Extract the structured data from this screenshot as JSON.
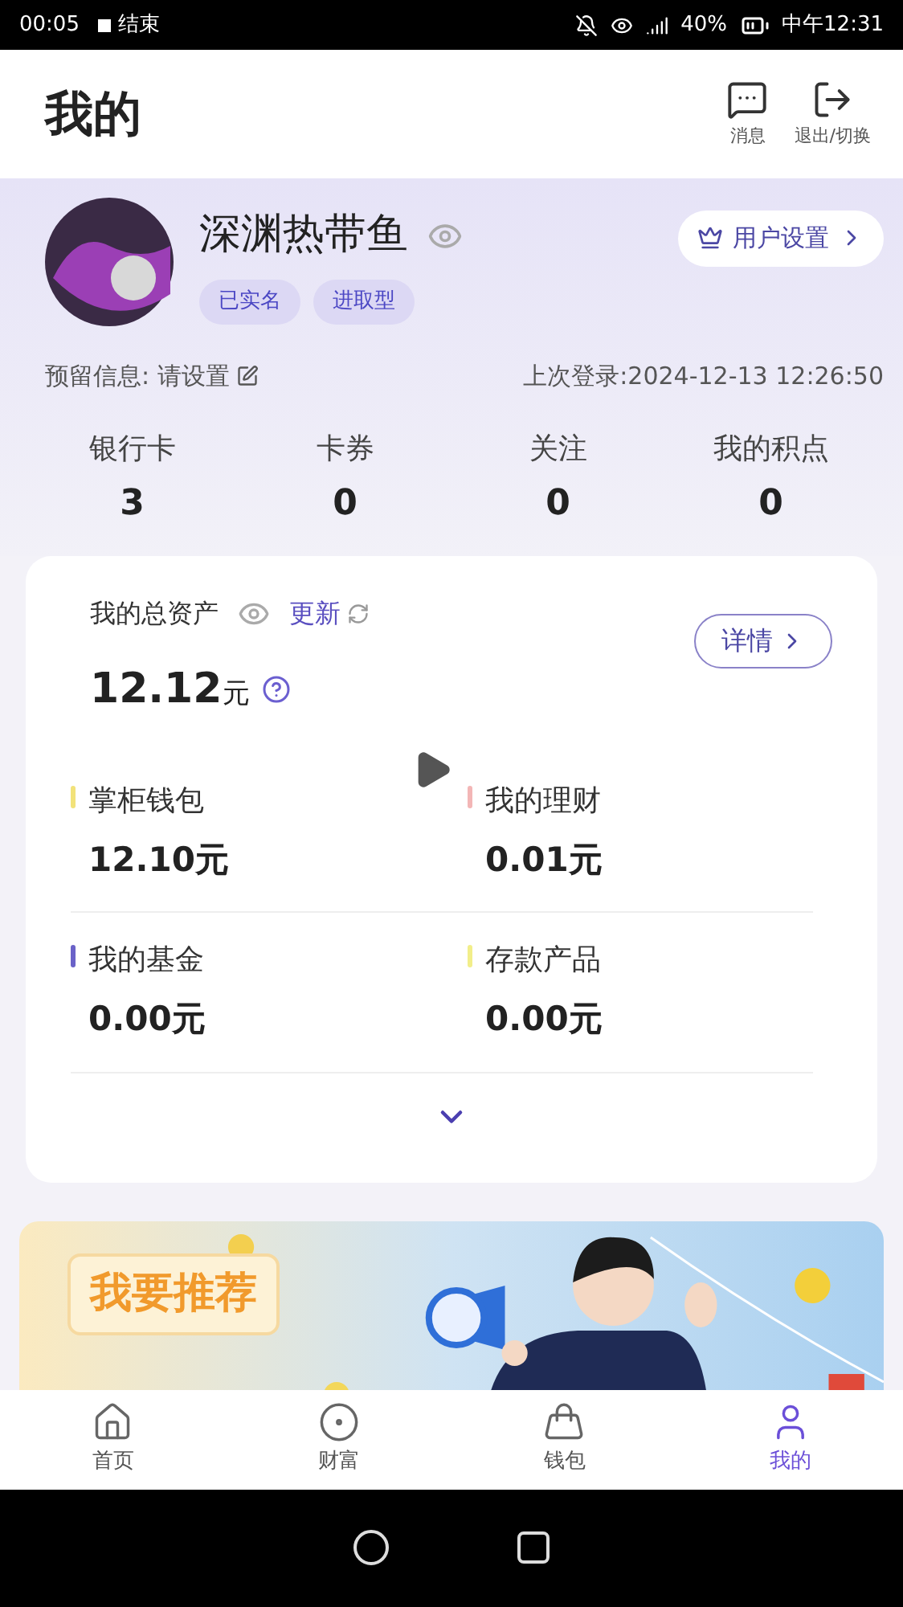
{
  "status_bar": {
    "recording_time": "00:05",
    "stop_label": "结束",
    "battery": "40%",
    "clock": "中午12:31"
  },
  "header": {
    "title": "我的",
    "actions": [
      {
        "label": "消息",
        "kind": "message"
      },
      {
        "label": "退出/切换",
        "kind": "logout"
      }
    ]
  },
  "profile": {
    "name": "深渊热带鱼",
    "tags": [
      "已实名",
      "进取型"
    ],
    "settings_button": "用户设置",
    "reserved_label": "预留信息: 请设置",
    "last_login": "上次登录:2024-12-13 12:26:50"
  },
  "stats": [
    {
      "label": "银行卡",
      "value": "3"
    },
    {
      "label": "卡券",
      "value": "0"
    },
    {
      "label": "关注",
      "value": "0"
    },
    {
      "label": "我的积点",
      "value": "0"
    }
  ],
  "assets": {
    "title": "我的总资产",
    "refresh": "更新",
    "details_button": "详情",
    "total": "12.12",
    "unit": "元",
    "items": [
      {
        "label": "掌柜钱包",
        "value": "12.10元",
        "color": "#f2e27a"
      },
      {
        "label": "我的理财",
        "value": "0.01元",
        "color": "#f3b6b6"
      },
      {
        "label": "我的基金",
        "value": "0.00元",
        "color": "#6a62c8"
      },
      {
        "label": "存款产品",
        "value": "0.00元",
        "color": "#f2ee8a"
      }
    ]
  },
  "banner": {
    "text": "我要推荐"
  },
  "tabs": [
    {
      "label": "首页",
      "kind": "home",
      "selected": false
    },
    {
      "label": "财富",
      "kind": "wealth",
      "selected": false
    },
    {
      "label": "钱包",
      "kind": "wallet",
      "selected": false
    },
    {
      "label": "我的",
      "kind": "me",
      "selected": true
    }
  ]
}
